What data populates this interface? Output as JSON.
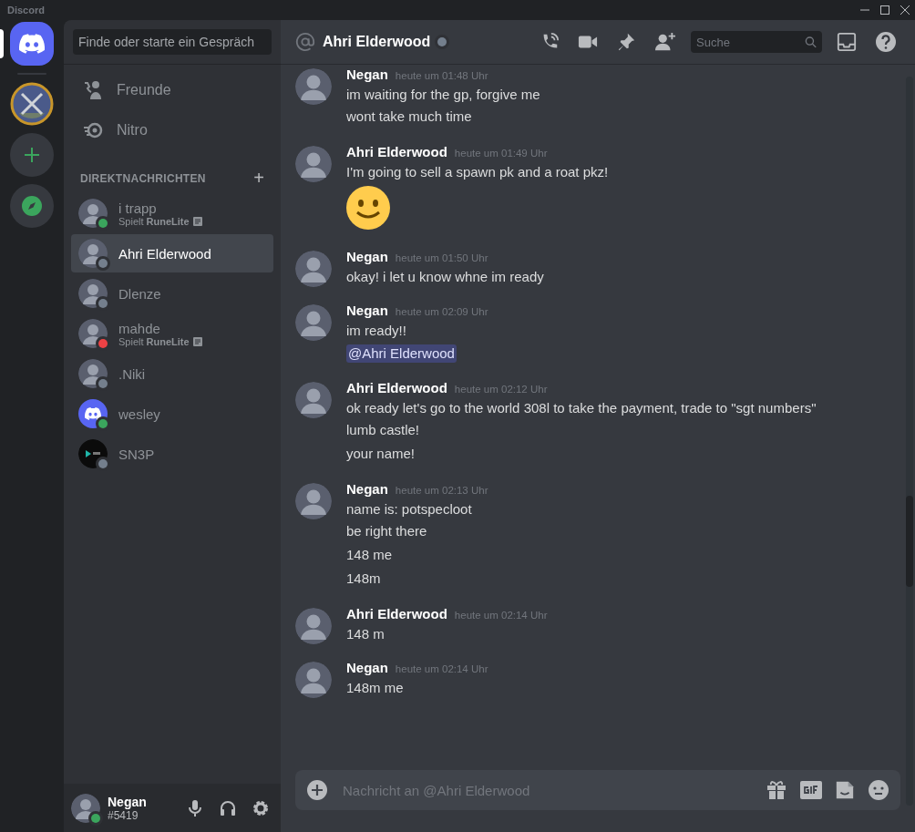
{
  "window": {
    "title": "Discord"
  },
  "servers": [
    {
      "kind": "home",
      "selected": true
    },
    {
      "kind": "server"
    },
    {
      "kind": "add"
    },
    {
      "kind": "explore"
    }
  ],
  "search": {
    "placeholder": "Finde oder starte ein Gespräch"
  },
  "nav": [
    {
      "kind": "friends",
      "label": "Freunde",
      "selected": false
    },
    {
      "kind": "nitro",
      "label": "Nitro",
      "selected": false
    }
  ],
  "dm_header": {
    "title": "DIREKTNACHRICHTEN",
    "add": "+"
  },
  "dms": [
    {
      "name": "i trapp",
      "activity": "Spielt **RuneLite**",
      "kind": "photo",
      "color": "#3ba55d",
      "selected": false
    },
    {
      "name": "Ahri Elderwood",
      "kind": "photo",
      "color": "#747f8d",
      "selected": true
    },
    {
      "name": "Dlenze",
      "kind": "photo",
      "color": "#747f8d",
      "selected": false
    },
    {
      "name": "mahde",
      "activity": "Spielt **RuneLite**",
      "kind": "photo",
      "color": "#ed4245",
      "selected": false
    },
    {
      "name": ".Niki",
      "kind": "photo",
      "color": "#747f8d",
      "selected": false
    },
    {
      "name": "wesley",
      "kind": "discord",
      "color": "#3ba55d",
      "selected": false
    },
    {
      "name": "SN3P",
      "kind": "logo",
      "color": "#747f8d",
      "selected": false
    }
  ],
  "user": {
    "name": "Negan",
    "tag": "#5419",
    "color": "#3ba55d"
  },
  "channel": {
    "title": "Ahri Elderwood",
    "color": "#747f8d",
    "search_placeholder": "Suche"
  },
  "messages": [
    {
      "author": "Negan",
      "time": "heute um 01:48 Uhr",
      "lines": [
        {
          "kind": "text",
          "text": "im waiting for the gp, forgive me"
        },
        {
          "kind": "text",
          "text": "wont take much time"
        }
      ]
    },
    {
      "author": "Ahri Elderwood",
      "time": "heute um 01:49 Uhr",
      "lines": [
        {
          "kind": "text",
          "text": "I'm going to sell a spawn pk and a roat pkz!"
        },
        {
          "kind": "emoji"
        }
      ]
    },
    {
      "author": "Negan",
      "time": "heute um 01:50 Uhr",
      "lines": [
        {
          "kind": "text",
          "text": "okay! i let u know whne im ready"
        }
      ]
    },
    {
      "author": "Negan",
      "time": "heute um 02:09 Uhr",
      "lines": [
        {
          "kind": "text",
          "text": "im ready!!"
        },
        {
          "kind": "mention",
          "text": "@Ahri Elderwood"
        }
      ]
    },
    {
      "author": "Ahri Elderwood",
      "time": "heute um 02:12 Uhr",
      "lines": [
        {
          "kind": "text",
          "text": "ok ready let's go to the world 308l to take the payment, trade to \"sgt numbers\""
        },
        {
          "kind": "text",
          "text": "lumb castle!"
        },
        {
          "kind": "text",
          "text": "your name!"
        }
      ]
    },
    {
      "author": "Negan",
      "time": "heute um 02:13 Uhr",
      "lines": [
        {
          "kind": "text",
          "text": "name is: potspecloot"
        },
        {
          "kind": "text",
          "text": "be right there"
        },
        {
          "kind": "text",
          "text": "148 me"
        },
        {
          "kind": "text",
          "text": "148m"
        }
      ]
    },
    {
      "author": "Ahri Elderwood",
      "time": "heute um 02:14 Uhr",
      "lines": [
        {
          "kind": "text",
          "text": "148 m"
        }
      ]
    },
    {
      "author": "Negan",
      "time": "heute um 02:14 Uhr",
      "lines": [
        {
          "kind": "text",
          "text": "148m me"
        }
      ]
    }
  ],
  "composer": {
    "placeholder": "Nachricht an @Ahri Elderwood"
  }
}
